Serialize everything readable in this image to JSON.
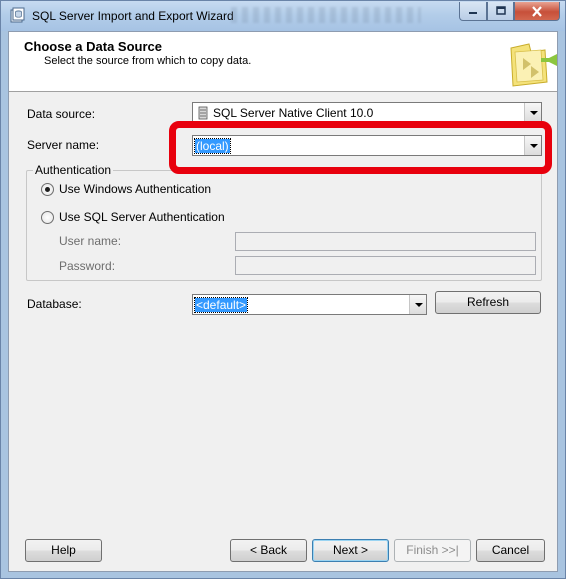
{
  "window": {
    "title": "SQL Server Import and Export Wizard"
  },
  "header": {
    "title": "Choose a Data Source",
    "subtitle": "Select the source from which to copy data."
  },
  "form": {
    "data_source_label": "Data source:",
    "data_source_value": "SQL Server Native Client 10.0",
    "server_name_label": "Server name:",
    "server_name_value": "(local)",
    "authentication_group": "Authentication",
    "auth_windows_label": "Use Windows Authentication",
    "auth_sql_label": "Use SQL Server Authentication",
    "auth_selected": "windows",
    "user_name_label": "User name:",
    "user_name_value": "",
    "password_label": "Password:",
    "password_value": "",
    "database_label": "Database:",
    "database_value": "<default>",
    "refresh_label": "Refresh"
  },
  "footer": {
    "help_label": "Help",
    "back_label": "< Back",
    "next_label": "Next >",
    "finish_label": "Finish >>|",
    "cancel_label": "Cancel"
  },
  "icons": {
    "app": "database-wizard-icon",
    "data_source": "server-icon",
    "header_art": "folder-arrow-graphic"
  },
  "colors": {
    "highlight": "#e8000d",
    "selection": "#3399ff"
  }
}
